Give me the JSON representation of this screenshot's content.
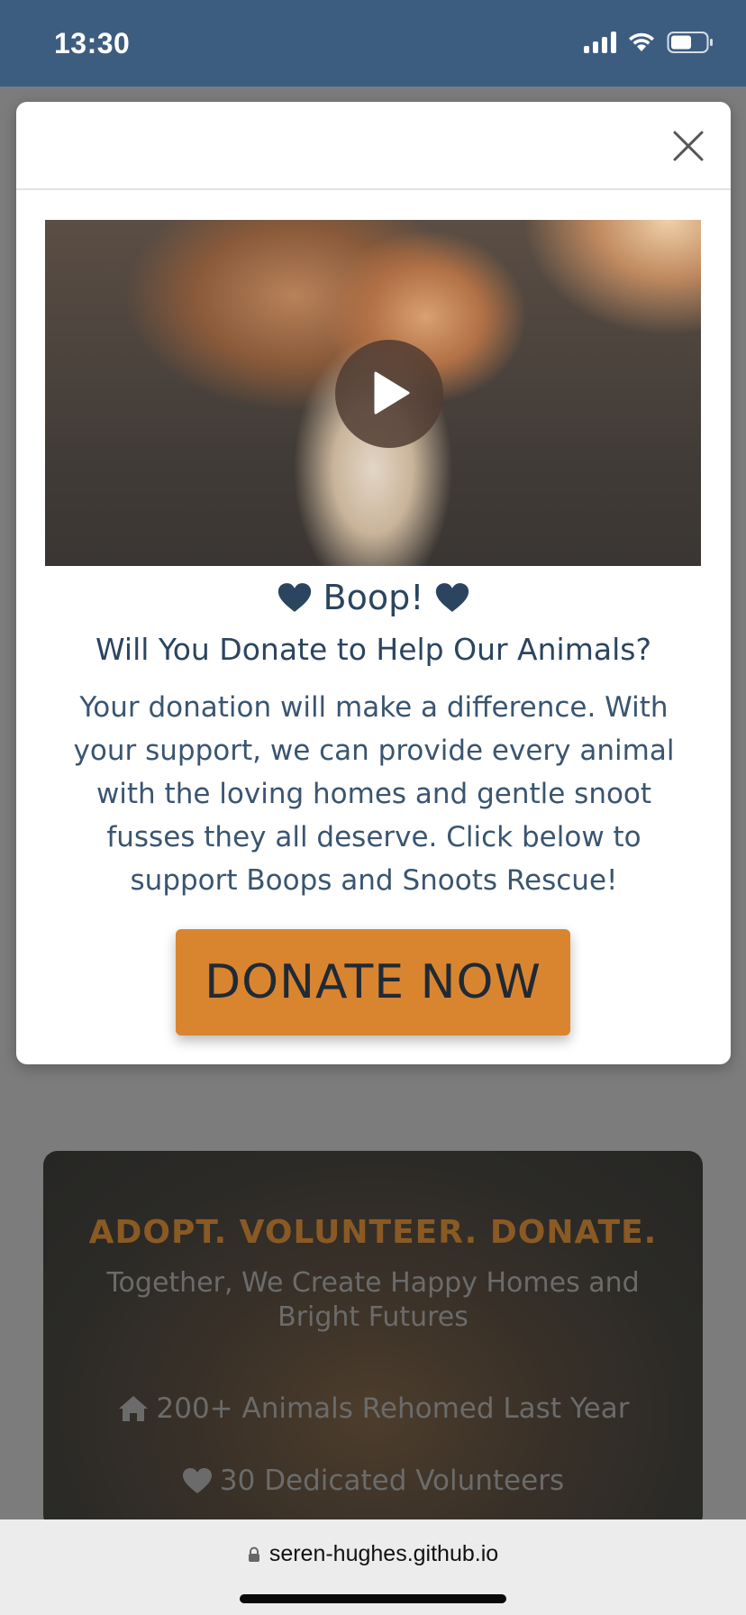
{
  "status_bar": {
    "time": "13:30"
  },
  "modal": {
    "title": "Boop!",
    "subtitle": "Will You Donate to Help Our Animals?",
    "body": "Your donation will make a difference. With your support, we can provide every animal with the loving homes and gentle snoot fusses they all deserve. Click below to support Boops and Snoots Rescue!",
    "donate_label": "DONATE NOW",
    "accent_color": "#d9852f",
    "text_color": "#2b4560"
  },
  "background_page": {
    "hero_title": "ADOPT. VOLUNTEER. DONATE.",
    "hero_subtitle": "Together, We Create Happy Homes and Bright Futures",
    "stats": [
      {
        "icon": "home-icon",
        "text": "200+ Animals Rehomed Last Year"
      },
      {
        "icon": "heart-icon",
        "text": "30 Dedicated Volunteers"
      }
    ]
  },
  "browser": {
    "url": "seren-hughes.github.io"
  }
}
